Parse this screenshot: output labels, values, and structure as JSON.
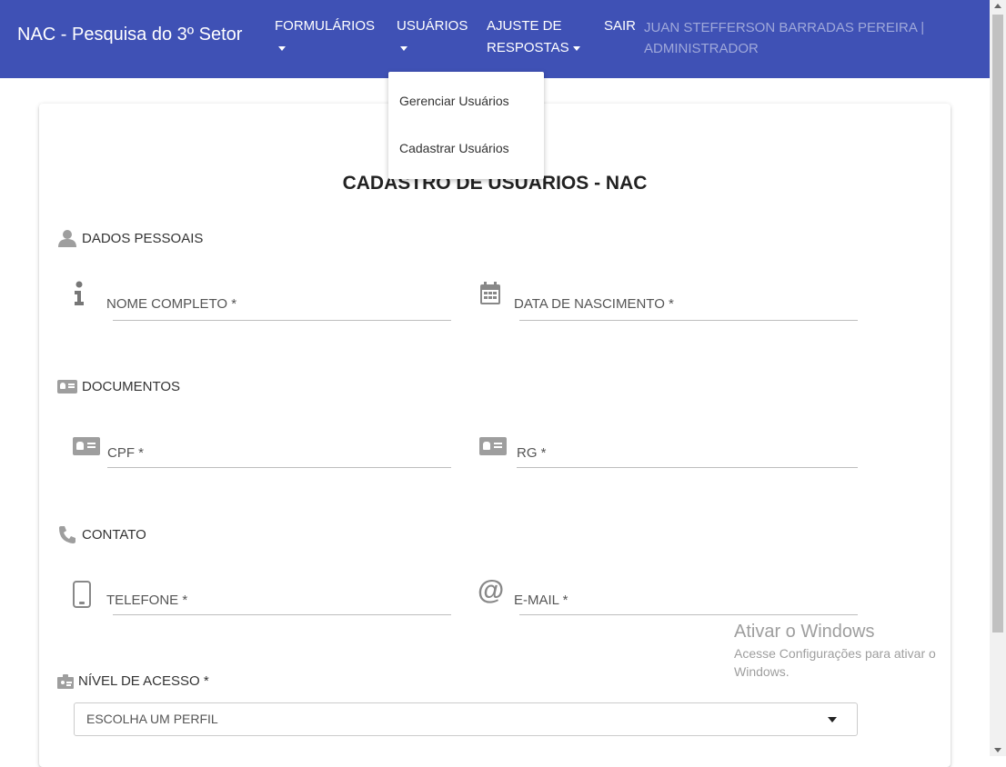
{
  "navbar": {
    "brand": "NAC - Pesquisa do 3º Setor",
    "formularios": "FORMULÁRIOS",
    "usuarios": "USUÁRIOS",
    "ajuste_line1": "AJUSTE DE",
    "ajuste_line2": "RESPOSTAS",
    "sair": "SAIR",
    "user_line1": "JUAN STEFFERSON BARRADAS PEREIRA |",
    "user_line2": "ADMINISTRADOR",
    "bg_color": "#3f51b5",
    "user_text_color": "#9fa8da"
  },
  "dropdown": {
    "items": [
      "Gerenciar Usuários",
      "Cadastrar Usuários"
    ]
  },
  "form": {
    "title": "CADASTRO DE USUÁRIOS - NAC",
    "sections": {
      "dados_pessoais": "DADOS PESSOAIS",
      "documentos": "DOCUMENTOS",
      "contato": "CONTATO",
      "nivel_acesso": "NÍVEL DE ACESSO *"
    },
    "fields": {
      "nome": "NOME COMPLETO *",
      "nascimento": "DATA DE NASCIMENTO *",
      "cpf": "CPF *",
      "rg": "RG *",
      "telefone": "TELEFONE *",
      "email": "E-MAIL *"
    },
    "perfil_select": "ESCOLHA UM PERFIL"
  },
  "watermark": {
    "title": "Ativar o Windows",
    "subtitle": "Acesse Configurações para ativar o Windows."
  },
  "icons": {
    "user": "user-icon",
    "info": "info-icon",
    "calendar": "calendar-icon",
    "id_card": "id-card-icon",
    "phone": "phone-icon",
    "mobile": "mobile-icon",
    "at": "at-sign-icon",
    "badge": "badge-icon"
  }
}
